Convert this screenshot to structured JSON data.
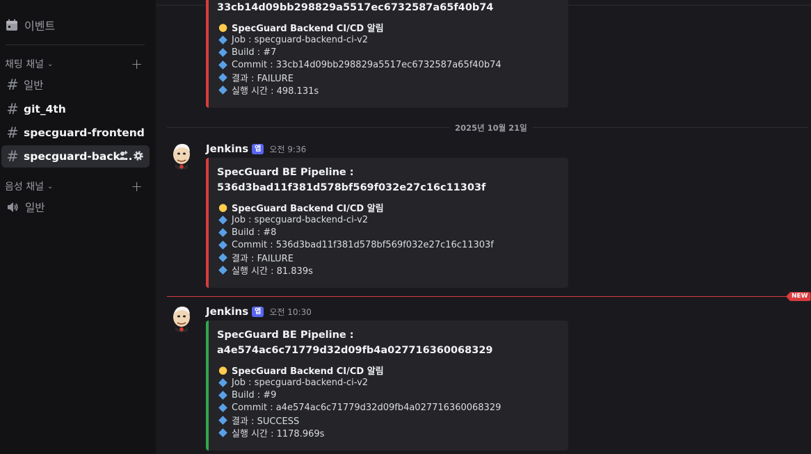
{
  "sidebar": {
    "event_label": "이벤트",
    "text_category": "채팅 채널",
    "voice_category": "음성 채널",
    "channels": [
      {
        "name": "일반"
      },
      {
        "name": "git_4th"
      },
      {
        "name": "specguard-frontend"
      },
      {
        "name": "specguard-back..."
      }
    ],
    "voice_channels": [
      {
        "name": "일반"
      }
    ]
  },
  "messages": {
    "top_title": "33cb14d09bb298829a5517ec6732587a65f40b74",
    "top_embed": {
      "heading": "SpecGuard Backend CI/CD 알림",
      "job": "Job : specguard-backend-ci-v2",
      "build": "Build : #7",
      "commit": "Commit : 33cb14d09bb298829a5517ec6732587a65f40b74",
      "result": "결과 : FAILURE",
      "duration": "실행 시간 : 498.131s"
    },
    "date_divider": "2025년 10월 21일",
    "new_badge": "NEW",
    "msg1": {
      "author": "Jenkins",
      "app_tag": "앱",
      "time": "오전 9:36",
      "title_line1": "SpecGuard BE Pipeline :",
      "title_line2": "536d3bad11f381d578bf569f032e27c16c11303f",
      "heading": "SpecGuard Backend CI/CD 알림",
      "job": "Job : specguard-backend-ci-v2",
      "build": "Build : #8",
      "commit": "Commit : 536d3bad11f381d578bf569f032e27c16c11303f",
      "result": "결과 : FAILURE",
      "duration": "실행 시간 : 81.839s"
    },
    "msg2": {
      "author": "Jenkins",
      "app_tag": "앱",
      "time": "오전 10:30",
      "title_line1": "SpecGuard BE Pipeline :",
      "title_line2": "a4e574ac6c71779d32d09fb4a027716360068329",
      "heading": "SpecGuard Backend CI/CD 알림",
      "job": "Job : specguard-backend-ci-v2",
      "build": "Build : #9",
      "commit": "Commit : a4e574ac6c71779d32d09fb4a027716360068329",
      "result": "결과 : SUCCESS",
      "duration": "실행 시간 : 1178.969s"
    }
  },
  "colors": {
    "failure_bar": "#d83c3e",
    "success_bar": "#2fa84f",
    "app_tag": "#5865f2",
    "new_divider": "#d83c3e"
  }
}
